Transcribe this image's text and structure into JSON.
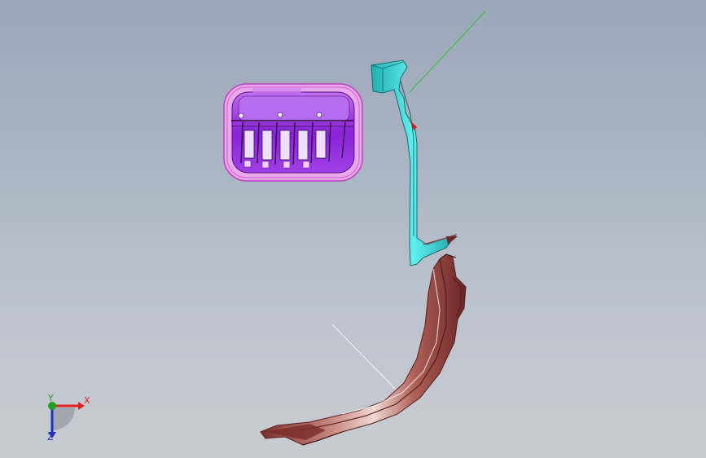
{
  "viewport": {
    "background_top": "#9aa7ba",
    "background_bottom": "#c8ccd2"
  },
  "parts": [
    {
      "id": "connector-housing",
      "color": "#9b30e0",
      "outline": "#e070e0"
    },
    {
      "id": "cyan-bracket",
      "color": "#40e0e0",
      "outline": "#208080"
    },
    {
      "id": "curved-trim-panel",
      "color": "#b86a62",
      "outline": "#6a2a2a"
    }
  ],
  "axes": {
    "x_label": "X",
    "y_label": "Y",
    "z_label": "Z",
    "x_color": "#e02020",
    "y_color": "#20a020",
    "z_color": "#2030c0"
  }
}
